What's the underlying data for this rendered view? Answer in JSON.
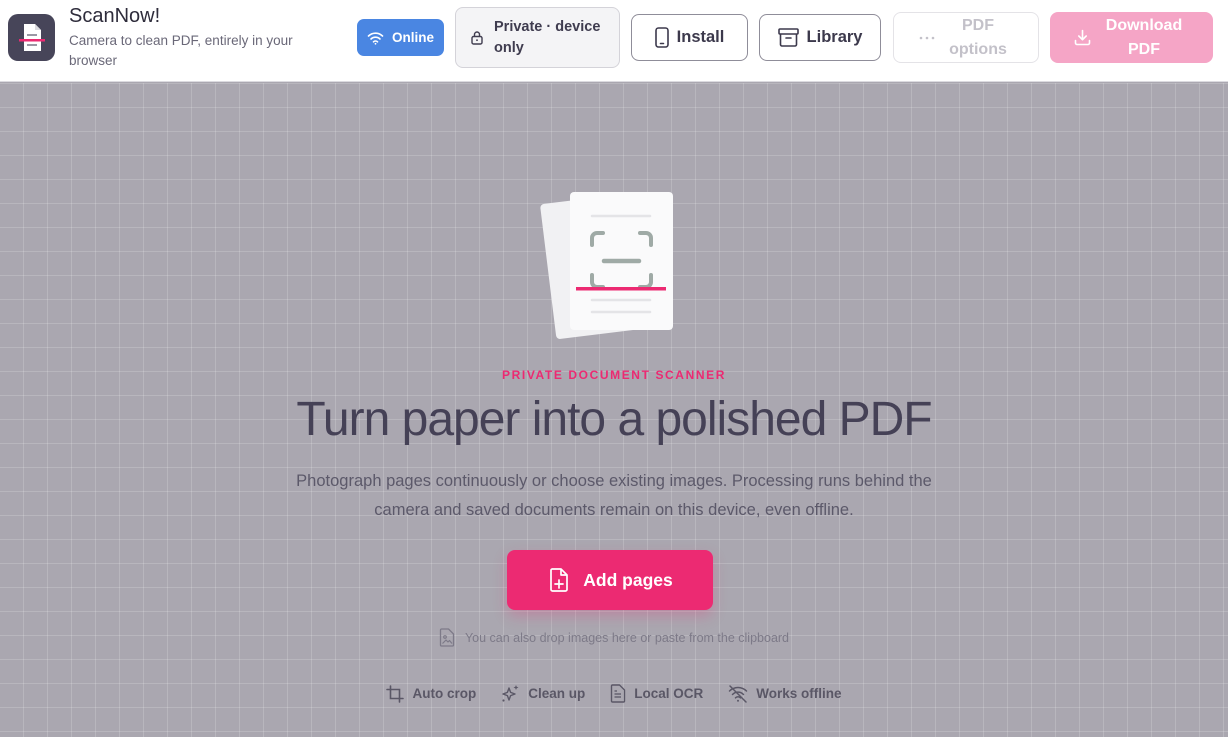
{
  "app": {
    "name": "ScanNow!",
    "tagline": "Camera to clean PDF, entirely in your browser",
    "logo_icon": "scanner-document-icon"
  },
  "header": {
    "online_label": "Online",
    "online_icon": "wifi-icon",
    "private_label": "Private · device only",
    "private_icon": "lock-icon",
    "install_label": "Install",
    "install_icon": "phone-icon",
    "library_label": "Library",
    "library_icon": "archive-box-icon",
    "pdf_options_label": "PDF options",
    "pdf_options_icon": "more-dots-icon",
    "download_label": "Download PDF",
    "download_icon": "download-icon"
  },
  "hero": {
    "eyebrow": "PRIVATE DOCUMENT SCANNER",
    "title": "Turn paper into a polished PDF",
    "description": "Photograph pages continuously or choose existing images. Processing runs behind the camera and saved documents remain on this device, even offline.",
    "add_pages_label": "Add pages",
    "add_pages_icon": "file-plus-icon",
    "drop_hint": "You can also drop images here or paste from the clipboard",
    "drop_icon": "image-file-icon"
  },
  "features": [
    {
      "label": "Auto crop",
      "icon": "crop-icon"
    },
    {
      "label": "Clean up",
      "icon": "sparkles-icon"
    },
    {
      "label": "Local OCR",
      "icon": "document-text-icon"
    },
    {
      "label": "Works offline",
      "icon": "wifi-off-icon"
    }
  ],
  "colors": {
    "accent": "#ec2a72",
    "online": "#4a86e2",
    "download_disabled": "#f5a5c6",
    "canvas_bg": "#aaa7b0",
    "title_text": "#454156"
  }
}
